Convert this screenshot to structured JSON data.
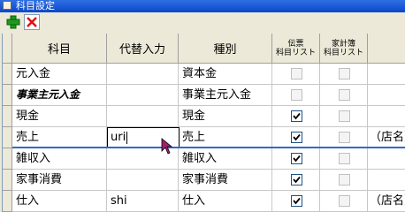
{
  "window": {
    "title": "科目設定"
  },
  "toolbar": {
    "add_icon": "plus-icon",
    "delete_icon": "delete-x-icon"
  },
  "columns": {
    "subject": "科目",
    "alt_input": "代替入力",
    "type": "種別",
    "slip_list": "伝票\n科目リスト",
    "household_list": "家計簿\n科目リスト"
  },
  "rows": [
    {
      "subject": "元入金",
      "alt_input": "",
      "type": "資本金",
      "slip_checked": false,
      "household_checked": false,
      "extra": ""
    },
    {
      "subject": "事業主元入金",
      "alt_input": "",
      "type": "事業主元入金",
      "slip_checked": false,
      "household_checked": false,
      "extra": ""
    },
    {
      "subject": "現金",
      "alt_input": "",
      "type": "現金",
      "slip_checked": true,
      "household_checked": false,
      "extra": ""
    },
    {
      "subject": "売上",
      "alt_input": "uri",
      "type": "売上",
      "slip_checked": true,
      "household_checked": false,
      "extra": "（店名）:"
    },
    {
      "subject": "雑収入",
      "alt_input": "",
      "type": "雑収入",
      "slip_checked": true,
      "household_checked": false,
      "extra": ""
    },
    {
      "subject": "家事消費",
      "alt_input": "",
      "type": "家事消費",
      "slip_checked": true,
      "household_checked": false,
      "extra": ""
    },
    {
      "subject": "仕入",
      "alt_input": "shi",
      "type": "仕入",
      "slip_checked": true,
      "household_checked": false,
      "extra": "（店名）:"
    }
  ]
}
